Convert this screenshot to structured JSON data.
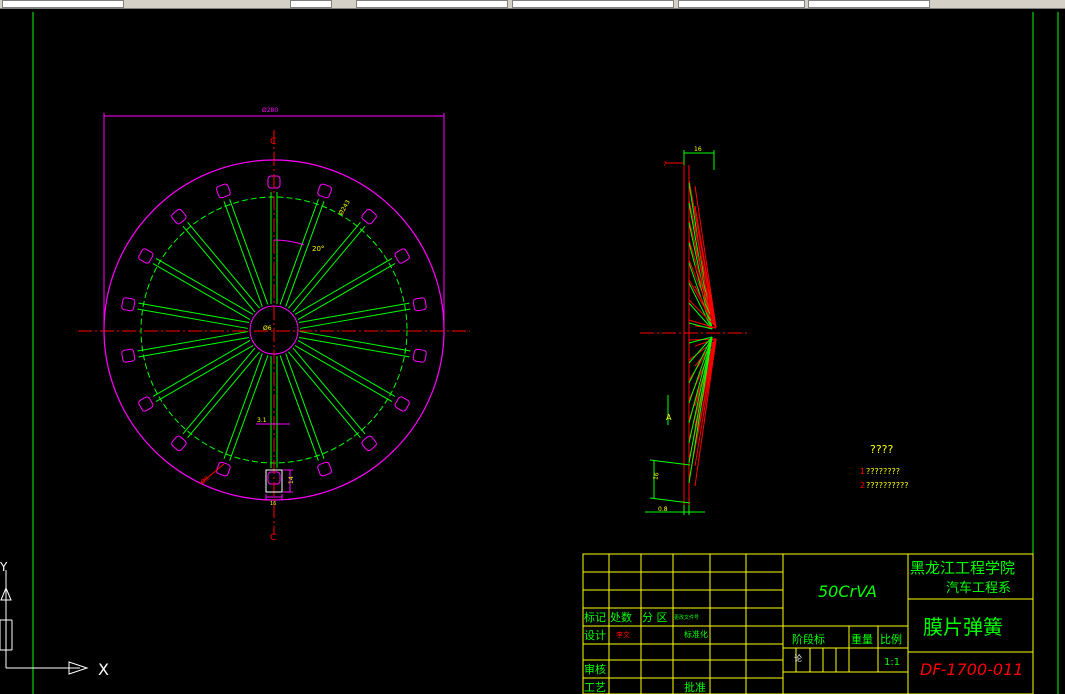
{
  "toolbar": {
    "fields": [
      "",
      "",
      "",
      "",
      ""
    ]
  },
  "drawing": {
    "front_view": {
      "width_dim": "Ø280",
      "outer_dim": "Ø243",
      "angle_dim": "20°",
      "slot_width_dim": "3.1",
      "inner_dim": "Ø6",
      "hole_dim": "Ø8",
      "slot_len_dim": "14",
      "slot_bottom_dim": "16",
      "centerline_label": "C",
      "slot_count": 18
    },
    "side_view": {
      "top_dim": "16",
      "left_marker": "7",
      "mid_dim": "A",
      "side_dim": "16",
      "bottom_dim": "0.8"
    },
    "notes": {
      "title": "????",
      "item1_num": "1",
      "item1": "????????",
      "item2_num": "2",
      "item2": "??????????"
    },
    "title_block": {
      "material": "50CrVA",
      "school": "黑龙江工程学院",
      "department": "汽车工程系",
      "part_name": "膜片弹簧",
      "drawing_no": "DF-1700-011",
      "row_mark": "标记",
      "row_count": "处数",
      "row_zone": "分 区",
      "row_doc": "更改文件号",
      "design": "设计",
      "designer": "李文",
      "standard": "标准化",
      "review": "审核",
      "process": "工艺",
      "approve": "批准",
      "stage": "阶段标",
      "weight": "重量",
      "scale_label": "比例",
      "scale": "1:1",
      "stage_mark": "论"
    },
    "ucs": {
      "x_label": "X",
      "y_label": "Y"
    }
  },
  "colors": {
    "background": "#000000",
    "border": "#00ff00",
    "magenta": "#ff00ff",
    "red": "#ff0000",
    "yellow": "#ffff00",
    "white": "#ffffff",
    "green": "#00ff00"
  }
}
